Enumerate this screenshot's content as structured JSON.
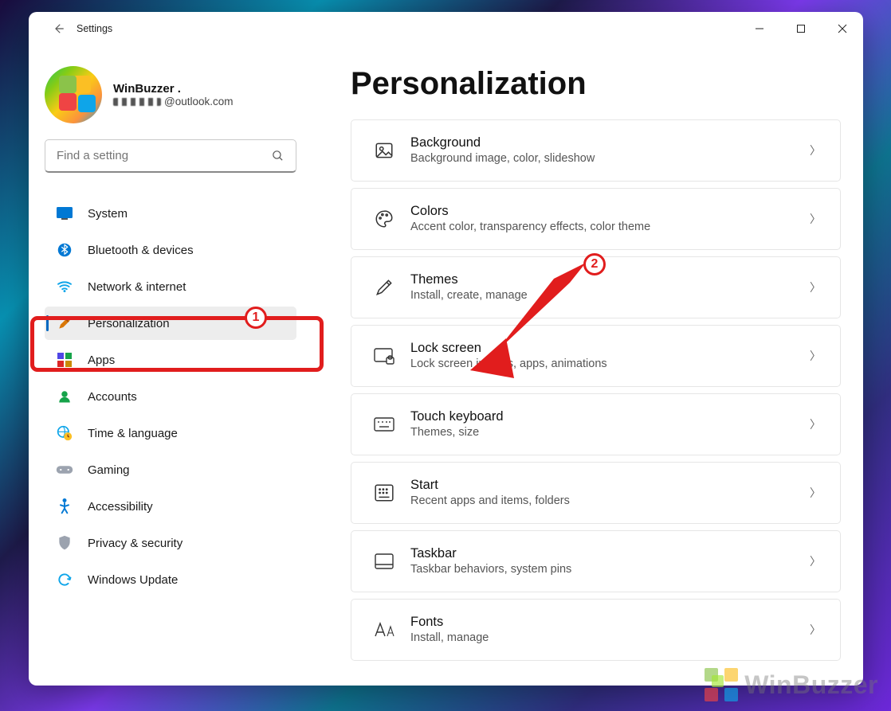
{
  "window": {
    "title": "Settings"
  },
  "profile": {
    "name": "WinBuzzer .",
    "email_suffix": "@outlook.com"
  },
  "search": {
    "placeholder": "Find a setting"
  },
  "nav": [
    {
      "id": "system",
      "label": "System",
      "icon": "🖥️",
      "active": false
    },
    {
      "id": "bluetooth",
      "label": "Bluetooth & devices",
      "icon": "bt",
      "active": false
    },
    {
      "id": "network",
      "label": "Network & internet",
      "icon": "wifi",
      "active": false
    },
    {
      "id": "personalization",
      "label": "Personalization",
      "icon": "brush",
      "active": true
    },
    {
      "id": "apps",
      "label": "Apps",
      "icon": "apps",
      "active": false
    },
    {
      "id": "accounts",
      "label": "Accounts",
      "icon": "person",
      "active": false
    },
    {
      "id": "time",
      "label": "Time & language",
      "icon": "globe-clock",
      "active": false
    },
    {
      "id": "gaming",
      "label": "Gaming",
      "icon": "gamepad",
      "active": false
    },
    {
      "id": "accessibility",
      "label": "Accessibility",
      "icon": "accessibility",
      "active": false
    },
    {
      "id": "privacy",
      "label": "Privacy & security",
      "icon": "shield",
      "active": false
    },
    {
      "id": "update",
      "label": "Windows Update",
      "icon": "sync",
      "active": false
    }
  ],
  "page": {
    "title": "Personalization"
  },
  "cards": [
    {
      "id": "background",
      "title": "Background",
      "desc": "Background image, color, slideshow"
    },
    {
      "id": "colors",
      "title": "Colors",
      "desc": "Accent color, transparency effects, color theme"
    },
    {
      "id": "themes",
      "title": "Themes",
      "desc": "Install, create, manage"
    },
    {
      "id": "lockscreen",
      "title": "Lock screen",
      "desc": "Lock screen images, apps, animations"
    },
    {
      "id": "touchkeyboard",
      "title": "Touch keyboard",
      "desc": "Themes, size"
    },
    {
      "id": "start",
      "title": "Start",
      "desc": "Recent apps and items, folders"
    },
    {
      "id": "taskbar",
      "title": "Taskbar",
      "desc": "Taskbar behaviors, system pins"
    },
    {
      "id": "fonts",
      "title": "Fonts",
      "desc": "Install, manage"
    }
  ],
  "annotations": {
    "badge1": "1",
    "badge2": "2"
  },
  "watermark": {
    "text": "WinBuzzer"
  }
}
